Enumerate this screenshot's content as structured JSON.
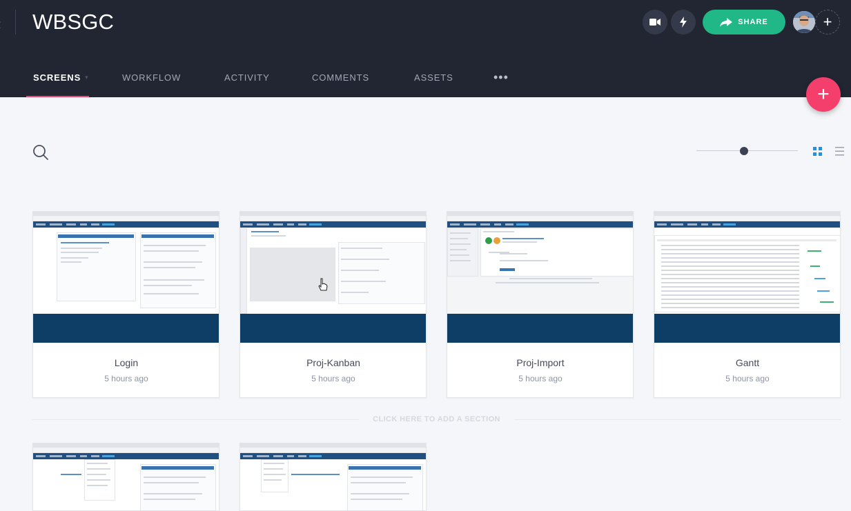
{
  "header": {
    "project_title": "WBSGC",
    "share_label": "SHARE",
    "back_glyph": "‹"
  },
  "icons": {
    "video": "video-icon",
    "bolt": "bolt-icon",
    "share": "share-arrow-icon",
    "add": "plus-icon",
    "search": "search-icon",
    "grid": "grid-view-icon",
    "list": "list-view-icon"
  },
  "tabs": [
    {
      "label": "SCREENS",
      "active": true
    },
    {
      "label": "WORKFLOW",
      "active": false
    },
    {
      "label": "ACTIVITY",
      "active": false
    },
    {
      "label": "COMMENTS",
      "active": false
    },
    {
      "label": "ASSETS",
      "active": false
    }
  ],
  "more_label": "•••",
  "fab_label": "+",
  "add_collaborator_label": "+",
  "zoom": {
    "level": 0.47
  },
  "colors": {
    "header_bg": "#222633",
    "accent_pink": "#f43f6c",
    "share_green": "#1fb886",
    "thumb_navy": "#0e3d66"
  },
  "screens": [
    {
      "name": "Login",
      "time": "5 hours ago"
    },
    {
      "name": "Proj-Kanban",
      "time": "5 hours ago"
    },
    {
      "name": "Proj-Import",
      "time": "5 hours ago"
    },
    {
      "name": "Gantt",
      "time": "5 hours ago"
    }
  ],
  "add_section_label": "CLICK HERE TO ADD A SECTION"
}
